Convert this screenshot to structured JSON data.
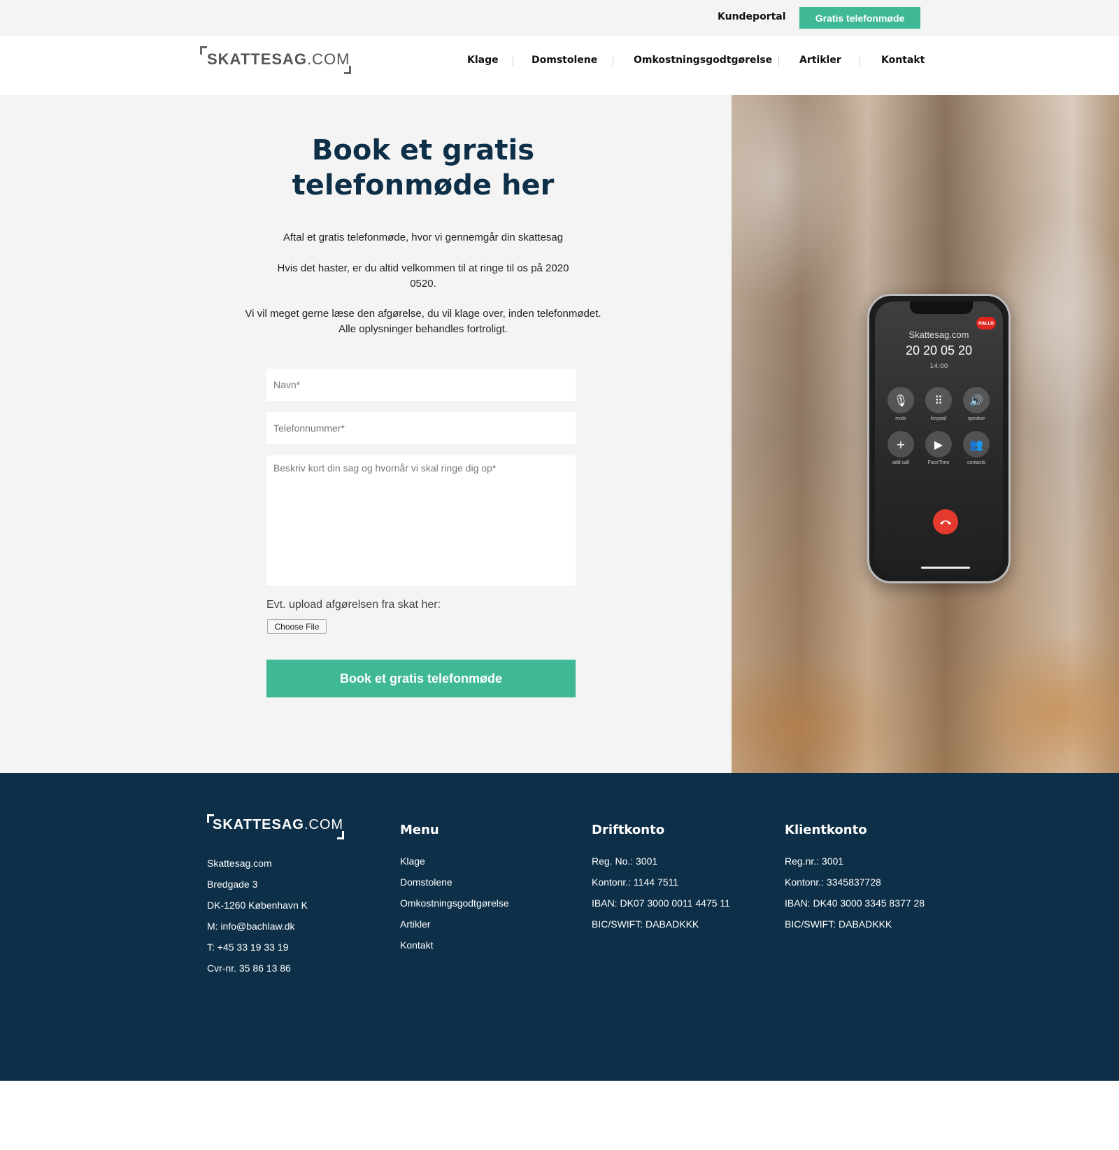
{
  "topbar": {
    "kundeportal": "Kundeportal",
    "gratis_button": "Gratis telefonmøde"
  },
  "logo": {
    "name": "SKATTESAG",
    "suffix": ".COM"
  },
  "nav": {
    "items": [
      "Klage",
      "Domstolene",
      "Omkostningsgodtgørelse",
      "Artikler",
      "Kontakt"
    ]
  },
  "hero": {
    "title_line1": "Book et gratis",
    "title_line2": "telefonmøde her",
    "intro1": "Aftal et gratis telefonmøde, hvor vi gennemgår din skattesag",
    "intro2": "Hvis det haster, er du altid velkommen til at ringe til os på 2020 0520.",
    "intro3": "Vi vil meget gerne læse den afgørelse, du vil klage over, inden telefonmødet. Alle oplysninger behandles fortroligt."
  },
  "form": {
    "name_placeholder": "Navn*",
    "phone_placeholder": "Telefonnummer*",
    "message_placeholder": "Beskriv kort din sag og hvornår vi skal ringe dig op*",
    "upload_label": "Evt. upload afgørelsen fra skat her:",
    "file_button": "Choose File",
    "submit_label": "Book et gratis telefonmøde"
  },
  "phone": {
    "badge": "HALLO",
    "caller": "Skattesag.com",
    "number": "20 20 05 20",
    "time": "14:00",
    "buttons": [
      {
        "icon": "mute-icon",
        "label": "mute",
        "glyph": "🎙"
      },
      {
        "icon": "keypad-icon",
        "label": "keypad",
        "glyph": "⠿"
      },
      {
        "icon": "speaker-icon",
        "label": "speaker",
        "glyph": "🔊"
      },
      {
        "icon": "add-call-icon",
        "label": "add call",
        "glyph": "+"
      },
      {
        "icon": "facetime-icon",
        "label": "FaceTime",
        "glyph": "▶"
      },
      {
        "icon": "contacts-icon",
        "label": "contacts",
        "glyph": "👥"
      }
    ]
  },
  "footer": {
    "logo_name": "SKATTESAG",
    "logo_suffix": ".COM",
    "address": [
      "Skattesag.com",
      "Bredgade 3",
      "DK-1260 København K",
      "M: info@bachlaw.dk",
      "T: +45 33 19 33 19",
      "Cvr-nr. 35 86 13 86"
    ],
    "menu_title": "Menu",
    "menu_items": [
      "Klage",
      "Domstolene",
      "Omkostningsgodtgørelse",
      "Artikler",
      "Kontakt"
    ],
    "drift_title": "Driftkonto",
    "drift_lines": [
      "Reg. No.: 3001",
      "Kontonr.: 1144 7511",
      "IBAN: DK07 3000 0011 4475 11",
      "BIC/SWIFT: DABADKKK"
    ],
    "klient_title": "Klientkonto",
    "klient_lines": [
      "Reg.nr.: 3001",
      "Kontonr.: 3345837728",
      "IBAN: DK40 3000 3345 8377 28",
      "BIC/SWIFT: DABADKKK"
    ]
  },
  "colors": {
    "accent_green": "#3fb895",
    "navy": "#0d2f47",
    "light_bg": "#f4f4f4"
  }
}
